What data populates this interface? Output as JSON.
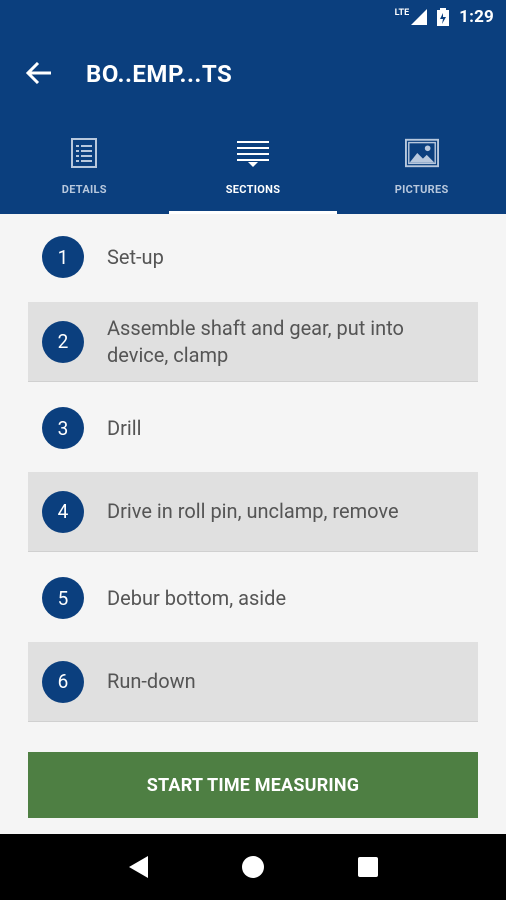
{
  "status_bar": {
    "network": "LTE",
    "time": "1:29"
  },
  "app_bar": {
    "title": "BO..EMP...TS"
  },
  "tabs": [
    {
      "label": "DETAILS",
      "icon": "list-document-icon",
      "active": false
    },
    {
      "label": "SECTIONS",
      "icon": "sections-icon",
      "active": true
    },
    {
      "label": "PICTURES",
      "icon": "picture-icon",
      "active": false
    }
  ],
  "sections": [
    {
      "number": "1",
      "text": "Set-up"
    },
    {
      "number": "2",
      "text": "Assemble shaft and gear, put into device, clamp"
    },
    {
      "number": "3",
      "text": "Drill"
    },
    {
      "number": "4",
      "text": "Drive in roll pin, unclamp, remove"
    },
    {
      "number": "5",
      "text": "Debur bottom, aside"
    },
    {
      "number": "6",
      "text": "Run-down"
    }
  ],
  "action": {
    "start_label": "START TIME MEASURING"
  },
  "colors": {
    "primary": "#0b3f7e",
    "button": "#4e7f43",
    "row_alt": "#e0e0e0"
  }
}
